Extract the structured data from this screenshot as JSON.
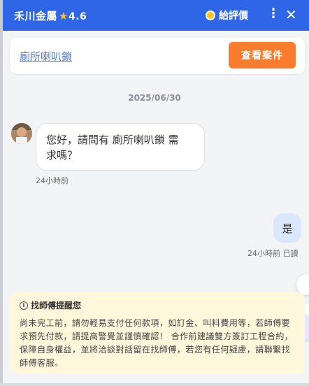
{
  "header": {
    "title": "禾川金屬",
    "rating": "4.6",
    "review_label": "給評價",
    "more_label": "⋮",
    "close_label": "✕"
  },
  "case_card": {
    "link_text": "廁所喇叭鎖",
    "button_label": "查看案件"
  },
  "chat": {
    "date": "2025/06/30",
    "incoming": {
      "text_line1": "您好，請問有 廁所喇叭鎖 需",
      "text_line2": "求嗎？",
      "time": "24小時前"
    },
    "outgoing": {
      "text": "是",
      "time": "24小時前 已讀"
    }
  },
  "notice": {
    "title": "找師傅提醒您",
    "body": "尚未完工前，請勿輕易支付任何款項，如訂金、叫料費用等，若師傅要求預先付款，請提高警覺並謹慎確認！ 合作前建議雙方簽訂工程合約，保障自身權益，並將洽談對話留在找師傅，若您有任何疑慮，請聯繫找師傅客服。"
  },
  "colors": {
    "header_bg": "#2f66e8",
    "button_bg": "#fa7d2d",
    "notice_bg": "#fef7dc",
    "outgoing_bubble": "#dbe7ff"
  }
}
